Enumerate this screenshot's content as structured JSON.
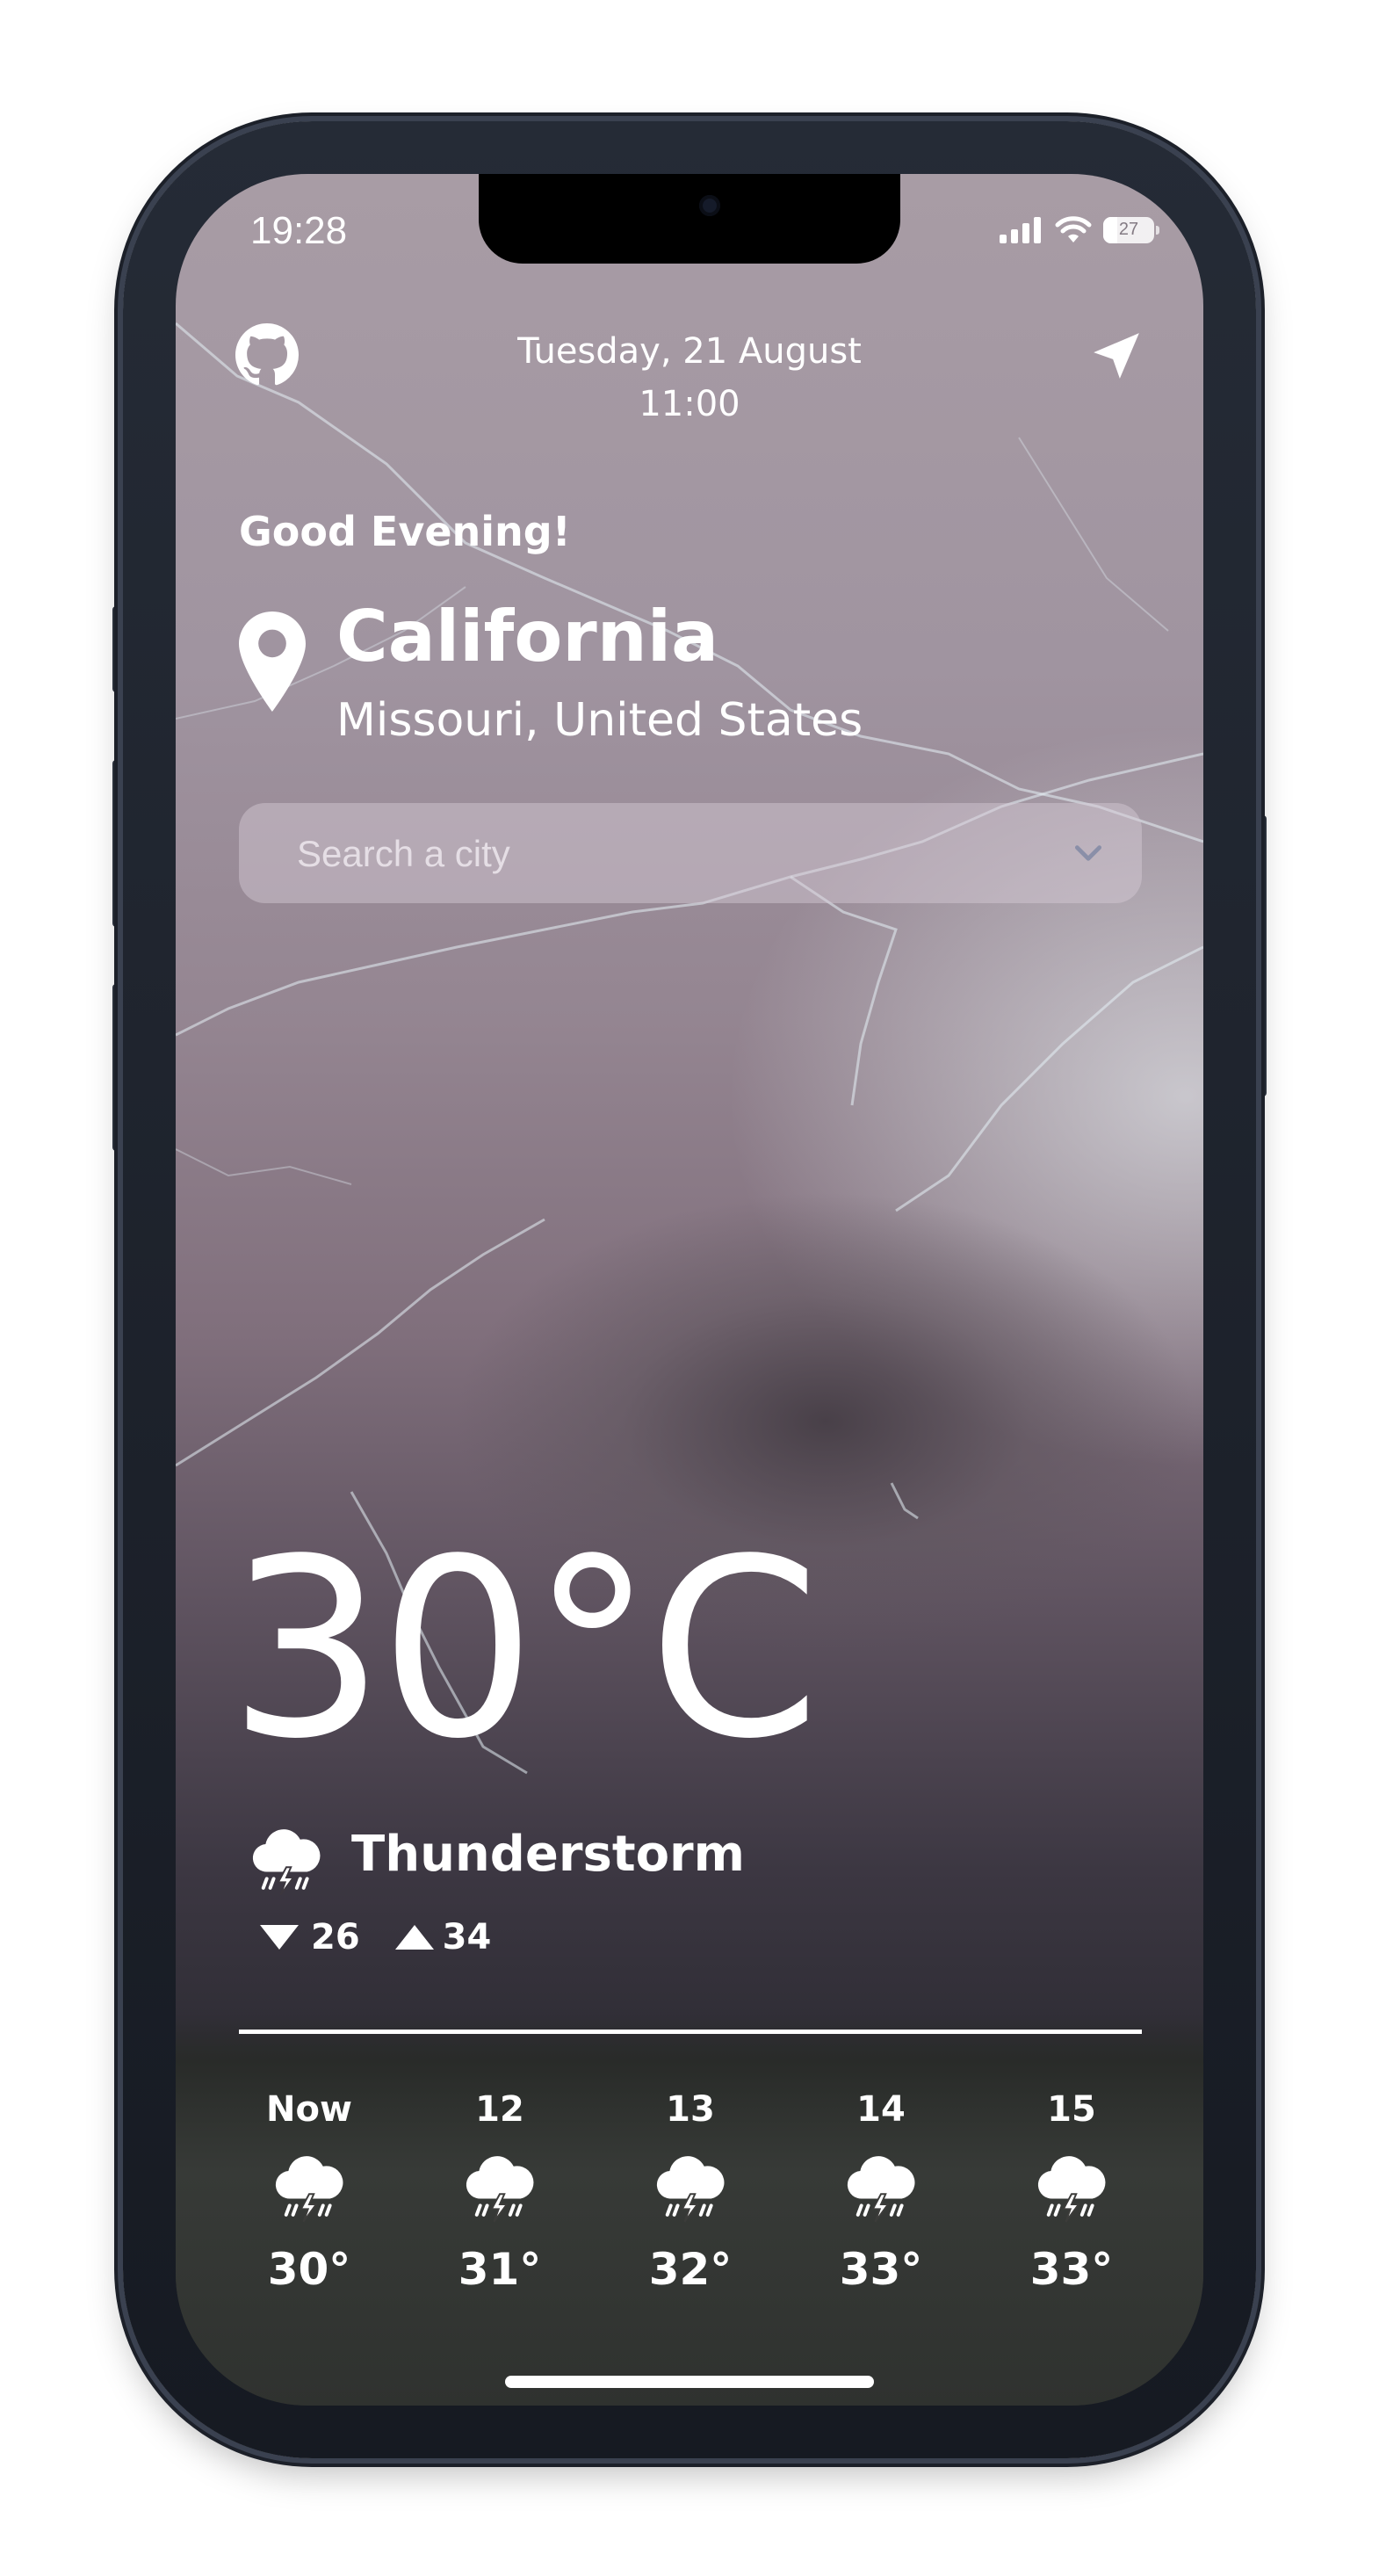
{
  "status_bar": {
    "time": "19:28",
    "battery": "27"
  },
  "header": {
    "date": "Tuesday, 21 August",
    "time": "11:00"
  },
  "greeting": "Good Evening!",
  "location": {
    "city": "California",
    "region": "Missouri, United States"
  },
  "search": {
    "placeholder": "Search a city"
  },
  "current": {
    "temperature": "30°C",
    "condition": "Thunderstorm",
    "min": "26",
    "max": "34"
  },
  "forecast": [
    {
      "hour": "Now",
      "temp": "30°"
    },
    {
      "hour": "12",
      "temp": "31°"
    },
    {
      "hour": "13",
      "temp": "32°"
    },
    {
      "hour": "14",
      "temp": "33°"
    },
    {
      "hour": "15",
      "temp": "33°"
    }
  ],
  "icons": {
    "github": "github-icon",
    "navigation": "navigation-arrow-icon",
    "pin": "location-pin-icon",
    "chevron": "chevron-down-icon",
    "weather": "thunderstorm-icon"
  },
  "colors": {
    "text": "#ffffff",
    "search_bg": "#d7cdd6"
  }
}
